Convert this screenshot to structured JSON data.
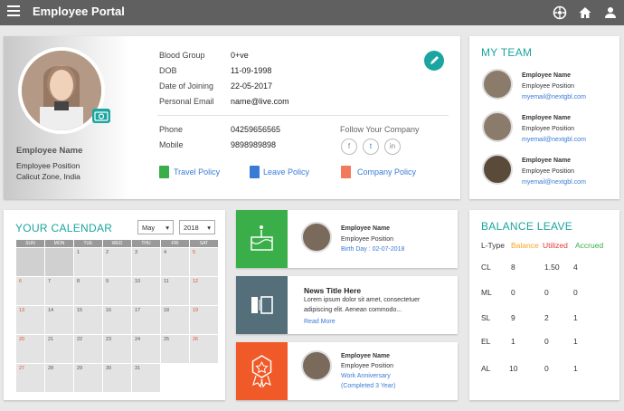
{
  "app": {
    "title": "Employee Portal"
  },
  "profile": {
    "name": "Employee Name",
    "position": "Employee Position",
    "location": "Calicut Zone, India",
    "fields": [
      {
        "label": "Blood Group",
        "value": "0+ve"
      },
      {
        "label": "DOB",
        "value": "11-09-1998"
      },
      {
        "label": "Date of Joining",
        "value": "22-05-2017"
      },
      {
        "label": "Personal Email",
        "value": "name@live.com"
      }
    ],
    "phone_label": "Phone",
    "phone": "04259656565",
    "mobile_label": "Mobile",
    "mobile": "9898989898",
    "follow_label": "Follow Your Company",
    "social": [
      "f",
      "t",
      "in"
    ],
    "policies": [
      "Travel Policy",
      "Leave Policy",
      "Company Policy"
    ]
  },
  "team": {
    "title": "MY TEAM",
    "members": [
      {
        "name": "Employee Name",
        "position": "Employee Position",
        "email": "myemail@nextgbl.com"
      },
      {
        "name": "Employee Name",
        "position": "Employee Position",
        "email": "myemail@nextgbl.com"
      },
      {
        "name": "Employee Name",
        "position": "Employee Position",
        "email": "myemail@nextgbl.com"
      }
    ]
  },
  "calendar": {
    "title": "YOUR CALENDAR",
    "month": "May",
    "year": "2018",
    "days": [
      "SUN",
      "MON",
      "TUE",
      "WED",
      "THU",
      "FRI",
      "SAT"
    ],
    "weeks": [
      [
        "",
        "",
        "1",
        "2",
        "3",
        "4",
        "5"
      ],
      [
        "6",
        "7",
        "8",
        "9",
        "10",
        "11",
        "12"
      ],
      [
        "13",
        "14",
        "15",
        "16",
        "17",
        "18",
        "19"
      ],
      [
        "20",
        "21",
        "22",
        "23",
        "24",
        "25",
        "26"
      ],
      [
        "27",
        "28",
        "29",
        "30",
        "31",
        "",
        ""
      ]
    ]
  },
  "events": {
    "birthday": {
      "name": "Employee Name",
      "position": "Employee Position",
      "detail": "Birth Day : 02-07-2018"
    },
    "news": {
      "title": "News Title Here",
      "text1": "Lorem ipsum dolor sit amet, consectetuer",
      "text2": "adipiscing elit. Aenean commodo...",
      "more": "Read More"
    },
    "anniversary": {
      "name": "Employee Name",
      "position": "Employee Position",
      "detail1": "Work Anniversary",
      "detail2": "(Completed 3 Year)"
    }
  },
  "balance": {
    "title": "BALANCE LEAVE",
    "headers": [
      "L-Type",
      "Balance",
      "Utilized",
      "Accrued"
    ],
    "rows": [
      [
        "CL",
        "8",
        "1.50",
        "4"
      ],
      [
        "ML",
        "0",
        "0",
        "0"
      ],
      [
        "SL",
        "9",
        "2",
        "1"
      ],
      [
        "EL",
        "1",
        "0",
        "1"
      ],
      [
        "AL",
        "10",
        "0",
        "1"
      ]
    ]
  },
  "colors": {
    "accent": "#1aa5a0",
    "green": "#3aae49",
    "slate": "#546e7a",
    "orange": "#f05a28",
    "link": "#3a7bd5"
  }
}
